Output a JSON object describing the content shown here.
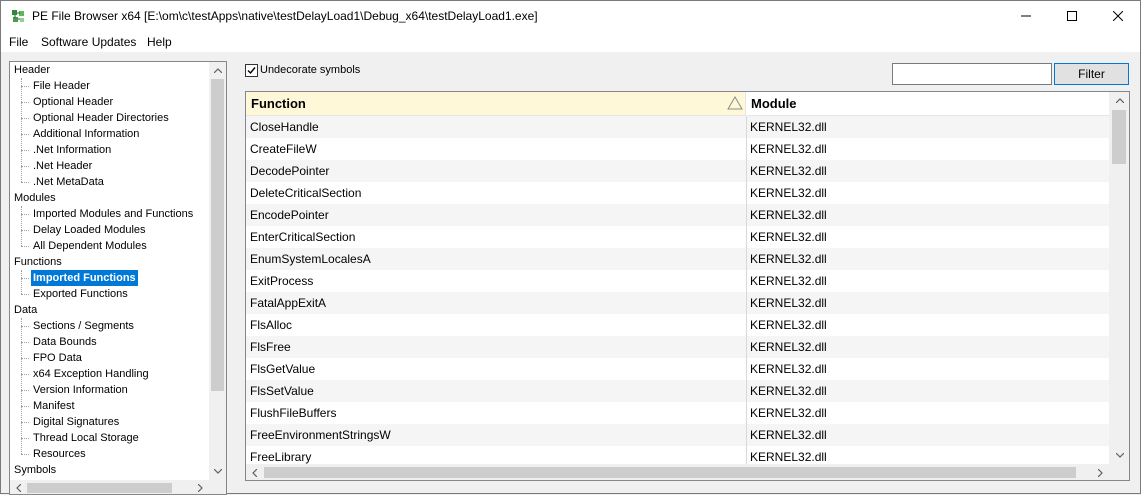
{
  "window": {
    "title": "PE File Browser x64 [E:\\om\\c\\testApps\\native\\testDelayLoad1\\Debug_x64\\testDelayLoad1.exe]"
  },
  "menu": [
    "File",
    "Software Updates",
    "Help"
  ],
  "tree": [
    {
      "label": "Header",
      "level": 0
    },
    {
      "label": "File Header",
      "level": 1
    },
    {
      "label": "Optional Header",
      "level": 1
    },
    {
      "label": "Optional Header Directories",
      "level": 1
    },
    {
      "label": "Additional Information",
      "level": 1
    },
    {
      "label": ".Net Information",
      "level": 1
    },
    {
      "label": ".Net Header",
      "level": 1
    },
    {
      "label": ".Net MetaData",
      "level": 1
    },
    {
      "label": "Modules",
      "level": 0
    },
    {
      "label": "Imported Modules and Functions",
      "level": 1
    },
    {
      "label": "Delay Loaded Modules",
      "level": 1
    },
    {
      "label": "All Dependent Modules",
      "level": 1
    },
    {
      "label": "Functions",
      "level": 0
    },
    {
      "label": "Imported Functions",
      "level": 1,
      "selected": true
    },
    {
      "label": "Exported Functions",
      "level": 1
    },
    {
      "label": "Data",
      "level": 0
    },
    {
      "label": "Sections / Segments",
      "level": 1
    },
    {
      "label": "Data Bounds",
      "level": 1
    },
    {
      "label": "FPO Data",
      "level": 1
    },
    {
      "label": "x64 Exception Handling",
      "level": 1
    },
    {
      "label": "Version Information",
      "level": 1
    },
    {
      "label": "Manifest",
      "level": 1
    },
    {
      "label": "Digital Signatures",
      "level": 1
    },
    {
      "label": "Thread Local Storage",
      "level": 1
    },
    {
      "label": "Resources",
      "level": 1
    },
    {
      "label": "Symbols",
      "level": 0
    }
  ],
  "options": {
    "undecorate_label": "Undecorate symbols",
    "undecorate_checked": true
  },
  "filter": {
    "value": "",
    "button_label": "Filter"
  },
  "table": {
    "columns": [
      "Function",
      "Module"
    ],
    "sort_column": "Function",
    "rows": [
      [
        "CloseHandle",
        "KERNEL32.dll"
      ],
      [
        "CreateFileW",
        "KERNEL32.dll"
      ],
      [
        "DecodePointer",
        "KERNEL32.dll"
      ],
      [
        "DeleteCriticalSection",
        "KERNEL32.dll"
      ],
      [
        "EncodePointer",
        "KERNEL32.dll"
      ],
      [
        "EnterCriticalSection",
        "KERNEL32.dll"
      ],
      [
        "EnumSystemLocalesA",
        "KERNEL32.dll"
      ],
      [
        "ExitProcess",
        "KERNEL32.dll"
      ],
      [
        "FatalAppExitA",
        "KERNEL32.dll"
      ],
      [
        "FlsAlloc",
        "KERNEL32.dll"
      ],
      [
        "FlsFree",
        "KERNEL32.dll"
      ],
      [
        "FlsGetValue",
        "KERNEL32.dll"
      ],
      [
        "FlsSetValue",
        "KERNEL32.dll"
      ],
      [
        "FlushFileBuffers",
        "KERNEL32.dll"
      ],
      [
        "FreeEnvironmentStringsW",
        "KERNEL32.dll"
      ],
      [
        "FreeLibrary",
        "KERNEL32.dll"
      ]
    ]
  },
  "icons": {
    "app": "app-icon",
    "minimize": "minimize-icon",
    "maximize": "maximize-icon",
    "close": "close-icon",
    "sort": "sort-ascending-icon"
  }
}
